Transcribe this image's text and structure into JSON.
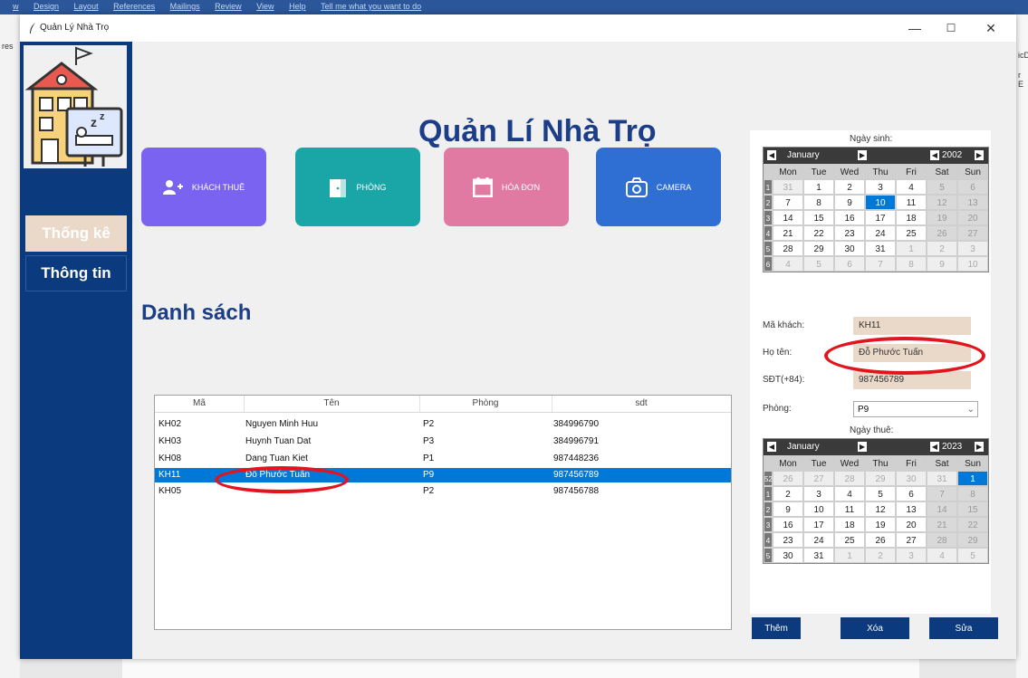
{
  "background": {
    "ribbon_items": [
      "w",
      "Design",
      "Layout",
      "References",
      "Mailings",
      "Review",
      "View",
      "Help",
      "Tell me what you want to do"
    ],
    "left_frag": "res",
    "right_frag1": "icD",
    "right_frag2": "r E"
  },
  "window": {
    "title": "Quản Lý Nhà Trọ",
    "min": "—",
    "max": "☐",
    "close": "✕"
  },
  "sidebar": {
    "stats": "Thống kê",
    "info": "Thông tin"
  },
  "app_title": "Quản Lí Nhà Trọ",
  "cards": [
    {
      "label": "KHÁCH THUÊ",
      "color": "#7a63f0",
      "icon": "add-user-icon"
    },
    {
      "label": "PHÒNG",
      "color": "#1aa6a6",
      "icon": "door-icon"
    },
    {
      "label": "HÓA ĐƠN",
      "color": "#e07aa2",
      "icon": "calendar-icon"
    },
    {
      "label": "CAMERA",
      "color": "#2f6fd4",
      "icon": "camera-icon"
    }
  ],
  "section_title": "Danh sách",
  "table": {
    "headers": [
      "Mã",
      "Tên",
      "Phòng",
      "sdt"
    ],
    "rows": [
      [
        "KH02",
        "Nguyen Minh Huu",
        "P2",
        "384996790"
      ],
      [
        "KH03",
        "Huynh Tuan Dat",
        "P3",
        "384996791"
      ],
      [
        "KH08",
        "Dang Tuan Kiet",
        "P1",
        "987448236"
      ],
      [
        "KH11",
        "Đỗ Phước Tuấn",
        "P9",
        "987456789"
      ],
      [
        "KH05",
        "",
        "P2",
        "987456788"
      ]
    ],
    "selected_index": 3
  },
  "form": {
    "birth_label": "Ngày sinh:",
    "id_label": "Mã khách:",
    "id_value": "KH11",
    "name_label": "Họ tên:",
    "name_value": "Đỗ Phước Tuấn",
    "phone_label": "SĐT(+84):",
    "phone_value": "987456789",
    "room_label": "Phòng:",
    "room_value": "P9",
    "rent_label": "Ngày thuê:",
    "highlight_color": "#ead8c8"
  },
  "calendar_birth": {
    "month": "January",
    "year": "2002",
    "weekdays": [
      "Mon",
      "Tue",
      "Wed",
      "Thu",
      "Fri",
      "Sat",
      "Sun"
    ],
    "weeks": [
      "1",
      "2",
      "3",
      "4",
      "5",
      "6"
    ],
    "days": [
      "31",
      "1",
      "2",
      "3",
      "4",
      "5",
      "6",
      "7",
      "8",
      "9",
      "10",
      "11",
      "12",
      "13",
      "14",
      "15",
      "16",
      "17",
      "18",
      "19",
      "20",
      "21",
      "22",
      "23",
      "24",
      "25",
      "26",
      "27",
      "28",
      "29",
      "30",
      "31",
      "1",
      "2",
      "3",
      "4",
      "5",
      "6",
      "7",
      "8",
      "9",
      "10"
    ],
    "selected": "10"
  },
  "calendar_rent": {
    "month": "January",
    "year": "2023",
    "weekdays": [
      "Mon",
      "Tue",
      "Wed",
      "Thu",
      "Fri",
      "Sat",
      "Sun"
    ],
    "weeks": [
      "52",
      "1",
      "2",
      "3",
      "4",
      "5"
    ],
    "days": [
      "26",
      "27",
      "28",
      "29",
      "30",
      "31",
      "1",
      "2",
      "3",
      "4",
      "5",
      "6",
      "7",
      "8",
      "9",
      "10",
      "11",
      "12",
      "13",
      "14",
      "15",
      "16",
      "17",
      "18",
      "19",
      "20",
      "21",
      "22",
      "23",
      "24",
      "25",
      "26",
      "27",
      "28",
      "29",
      "30",
      "31",
      "1",
      "2",
      "3",
      "4",
      "5"
    ],
    "selected": "1"
  },
  "buttons": {
    "add": "Thêm",
    "delete": "Xóa",
    "edit": "Sửa"
  },
  "annotation_color": "#e0151e"
}
